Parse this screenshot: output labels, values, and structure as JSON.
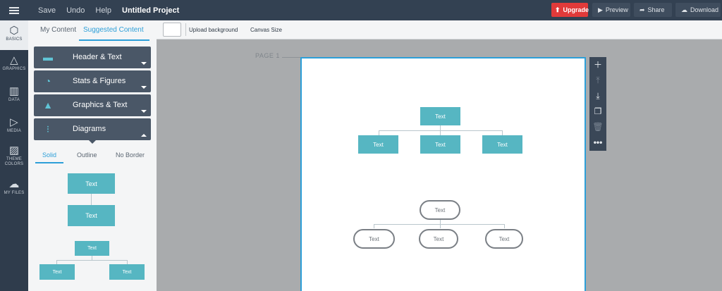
{
  "topbar": {
    "menu": [
      "Save",
      "Undo",
      "Help"
    ],
    "project_title": "Untitled Project",
    "upgrade_label": "Upgrade",
    "preview_label": "Preview",
    "share_label": "Share",
    "download_label": "Download"
  },
  "rail": {
    "items": [
      {
        "label": "BASICS",
        "icon": "cube-icon"
      },
      {
        "label": "GRAPHICS",
        "icon": "shapes-icon"
      },
      {
        "label": "DATA",
        "icon": "chart-icon"
      },
      {
        "label": "MEDIA",
        "icon": "media-icon"
      },
      {
        "label": "THEME COLORS",
        "icon": "pattern-icon"
      },
      {
        "label": "MY FILES",
        "icon": "cloud-upload-icon"
      }
    ]
  },
  "panel": {
    "tabs": [
      "My Content",
      "Suggested Content"
    ],
    "categories": [
      {
        "label": "Header & Text"
      },
      {
        "label": "Stats & Figures"
      },
      {
        "label": "Graphics & Text"
      },
      {
        "label": "Diagrams"
      }
    ],
    "style_tabs": [
      "Solid",
      "Outline",
      "No Border"
    ],
    "preview_box_text": "Text"
  },
  "toolbar": {
    "upload_background": "Upload background",
    "canvas_size": "Canvas Size"
  },
  "canvas": {
    "page_label": "PAGE 1",
    "box_text": "Text"
  },
  "colors": {
    "accent": "#2d9fd8",
    "teal_box": "#56b6c2",
    "upgrade": "#e13a3a",
    "topbar": "#334152"
  }
}
